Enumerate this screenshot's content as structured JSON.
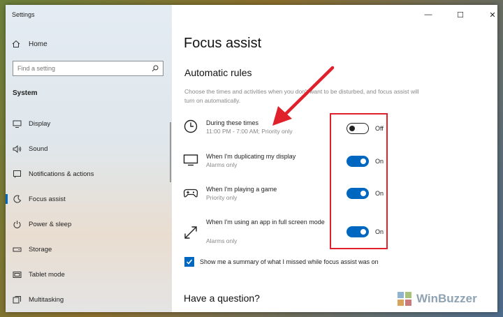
{
  "window": {
    "app_title": "Settings",
    "controls": {
      "minimize": "—",
      "maximize": "☐",
      "close": "✕"
    }
  },
  "sidebar": {
    "home_label": "Home",
    "search_placeholder": "Find a setting",
    "section_label": "System",
    "items": [
      {
        "label": "Display",
        "icon": "display-icon"
      },
      {
        "label": "Sound",
        "icon": "sound-icon"
      },
      {
        "label": "Notifications & actions",
        "icon": "notifications-icon"
      },
      {
        "label": "Focus assist",
        "icon": "focus-assist-icon",
        "active": true
      },
      {
        "label": "Power & sleep",
        "icon": "power-icon"
      },
      {
        "label": "Storage",
        "icon": "storage-icon"
      },
      {
        "label": "Tablet mode",
        "icon": "tablet-icon"
      },
      {
        "label": "Multitasking",
        "icon": "multitasking-icon"
      }
    ]
  },
  "main": {
    "title": "Focus assist",
    "subtitle": "Automatic rules",
    "description": "Choose the times and activities when you don't want to be disturbed, and focus assist will turn on automatically.",
    "rules": [
      {
        "name": "During these times",
        "sub": "11:00 PM - 7:00 AM; Priority only",
        "state": "Off",
        "on": false,
        "icon": "clock-icon"
      },
      {
        "name": "When I'm duplicating my display",
        "sub": "Alarms only",
        "state": "On",
        "on": true,
        "icon": "monitor-icon"
      },
      {
        "name": "When I'm playing a game",
        "sub": "Priority only",
        "state": "On",
        "on": true,
        "icon": "gamepad-icon"
      },
      {
        "name": "When I'm using an app in full screen mode",
        "sub": "Alarms only",
        "state": "On",
        "on": true,
        "icon": "fullscreen-icon"
      }
    ],
    "summary_checkbox": {
      "label": "Show me a summary of what I missed while focus assist was on",
      "checked": true
    },
    "question_heading": "Have a question?"
  },
  "colors": {
    "accent": "#0067c0",
    "annotation": "#e0202a"
  },
  "watermark": {
    "text": "WinBuzzer"
  }
}
